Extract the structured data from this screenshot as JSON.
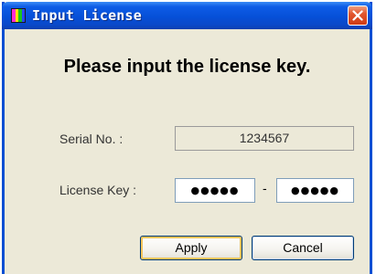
{
  "window": {
    "title": "Input License",
    "close_icon": "close-icon"
  },
  "heading": "Please input the license key.",
  "serial": {
    "label": "Serial No. :",
    "value": "1234567"
  },
  "license": {
    "label": "License Key :",
    "part1": "●●●●●",
    "separator": "-",
    "part2": "●●●●●"
  },
  "buttons": {
    "apply_label": "Apply",
    "cancel_label": "Cancel"
  },
  "colors": {
    "titlebar": "#0650d8",
    "close_button": "#e2562e",
    "dialog_background": "#ece9d8",
    "default_button_focus": "#f5c45a"
  }
}
